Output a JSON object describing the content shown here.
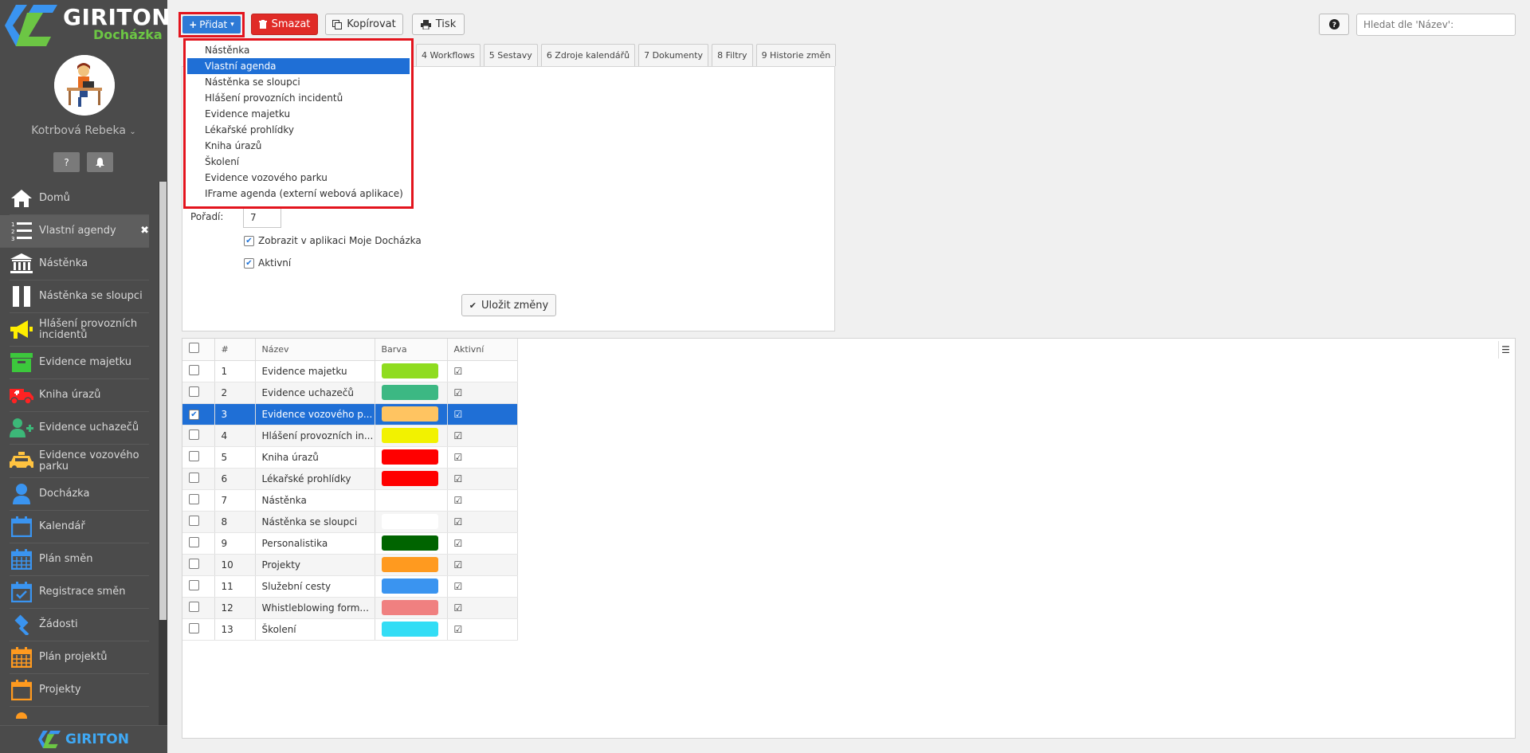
{
  "app": {
    "brand": "GIRITON",
    "product": "Docházka",
    "footer_brand": "GIRITON"
  },
  "user": {
    "name": "Kotrbová Rebeka"
  },
  "sidebar": {
    "items": [
      {
        "label": "Domů",
        "icon": "home-icon",
        "color": "#ffffff"
      },
      {
        "label": "Vlastní agendy",
        "icon": "numbered-list-icon",
        "color": "#ffffff"
      },
      {
        "label": "Nástěnka",
        "icon": "bank-icon",
        "color": "#ffffff"
      },
      {
        "label": "Nástěnka se sloupci",
        "icon": "columns-icon",
        "color": "#ffffff"
      },
      {
        "label": "Hlášení provozních incidentů",
        "icon": "megaphone-icon",
        "color": "#ffee00"
      },
      {
        "label": "Evidence majetku",
        "icon": "archive-box-icon",
        "color": "#3cc83c"
      },
      {
        "label": "Kniha úrazů",
        "icon": "ambulance-icon",
        "color": "#ff2222"
      },
      {
        "label": "Evidence uchazečů",
        "icon": "user-plus-icon",
        "color": "#3cb878"
      },
      {
        "label": "Evidence vozového parku",
        "icon": "taxi-icon",
        "color": "#ffc340"
      },
      {
        "label": "Docházka",
        "icon": "person-icon",
        "color": "#3a94f0"
      },
      {
        "label": "Kalendář",
        "icon": "calendar-icon",
        "color": "#3a94f0"
      },
      {
        "label": "Plán směn",
        "icon": "calendar-grid-icon",
        "color": "#3a94f0"
      },
      {
        "label": "Registrace směn",
        "icon": "calendar-check-icon",
        "color": "#3a94f0"
      },
      {
        "label": "Žádosti",
        "icon": "gavel-icon",
        "color": "#3a94f0"
      },
      {
        "label": "Plán projektů",
        "icon": "calendar-grid-icon",
        "color": "#ff9a1f"
      },
      {
        "label": "Projekty",
        "icon": "calendar-icon",
        "color": "#ff9a1f"
      },
      {
        "label": "",
        "icon": "person-icon",
        "color": "#ff9a1f"
      }
    ]
  },
  "toolbar": {
    "add": "Přidat",
    "delete": "Smazat",
    "copy": "Kopírovat",
    "print": "Tisk",
    "search_placeholder": "Hledat dle 'Název':"
  },
  "tabs": [
    "4 Workflows",
    "5 Sestavy",
    "6 Zdroje kalendářů",
    "7 Dokumenty",
    "8 Filtry",
    "9 Historie změn"
  ],
  "add_menu": {
    "items": [
      "Nástěnka",
      "Vlastní agenda",
      "Nástěnka se sloupci",
      "Hlášení provozních incidentů",
      "Evidence majetku",
      "Lékařské prohlídky",
      "Kniha úrazů",
      "Školení",
      "Evidence vozového parku",
      "IFrame agenda (externí webová aplikace)"
    ],
    "selected_index": 1
  },
  "form": {
    "order_label": "Pořadí:",
    "order_value": "7",
    "show_in_app": "Zobrazit v aplikaci Moje Docházka",
    "active": "Aktivní",
    "save": "Uložit změny"
  },
  "grid": {
    "headers": [
      "#",
      "Název",
      "Barva",
      "Aktivní"
    ],
    "selected_row": 3,
    "rows": [
      {
        "num": "1",
        "name": "Evidence majetku",
        "color": "#8fdc1f",
        "active": true
      },
      {
        "num": "2",
        "name": "Evidence uchazečů",
        "color": "#3cb883",
        "active": true
      },
      {
        "num": "3",
        "name": "Evidence vozového p...",
        "color": "#ffc461",
        "active": true
      },
      {
        "num": "4",
        "name": "Hlášení provozních in...",
        "color": "#f2f200",
        "active": true
      },
      {
        "num": "5",
        "name": "Kniha úrazů",
        "color": "#ff0000",
        "active": true
      },
      {
        "num": "6",
        "name": "Lékařské prohlídky",
        "color": "#ff0000",
        "active": true
      },
      {
        "num": "7",
        "name": "Nástěnka",
        "color": "#ffffff",
        "active": true
      },
      {
        "num": "8",
        "name": "Nástěnka se sloupci",
        "color": "#ffffff",
        "active": true
      },
      {
        "num": "9",
        "name": "Personalistika",
        "color": "#006400",
        "active": true
      },
      {
        "num": "10",
        "name": "Projekty",
        "color": "#ff9a1f",
        "active": true
      },
      {
        "num": "11",
        "name": "Služební cesty",
        "color": "#3a94f0",
        "active": true
      },
      {
        "num": "12",
        "name": "Whistleblowing form...",
        "color": "#f08080",
        "active": true
      },
      {
        "num": "13",
        "name": "Školení",
        "color": "#33ddf5",
        "active": true
      }
    ]
  }
}
